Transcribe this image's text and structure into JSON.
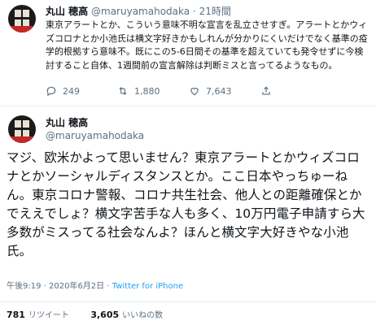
{
  "tweet1": {
    "display_name": "丸山 穂高",
    "handle": "@maruyamahodaka",
    "separator": "·",
    "time": "21時間",
    "text": "東京アラートとか、こういう意味不明な宣言を乱立させすぎ。アラートとかウィズコロナとか小池氏は横文字好きかもしれんが分かりにくいだけでなく基準の疫学的根拠すら意味不。既にこの5-6日間その基準を超えていても発令せずに今検討すること自体、1週間前の宣言解除は判断ミスと言ってるようなもの。",
    "actions": {
      "reply_count": "249",
      "retweet_count": "1,880",
      "like_count": "7,643"
    }
  },
  "tweet2": {
    "display_name": "丸山 穂高",
    "handle": "@maruyamahodaka",
    "text": "マジ、欧米かよって思いません？東京アラートとかウィズコロナとかソーシャルディスタンスとか。ここ日本やっちゅーねん。東京コロナ警報、コロナ共生社会、他人との距離確保とかでええでしょ？横文字苦手な人も多く、10万円電子申請すら大多数がミスってる社会なんよ？ほんと横文字大好きやな小池氏。",
    "meta": {
      "timestamp": "午後9:19 · 2020年6月2日",
      "separator": "·",
      "source": "Twitter for iPhone"
    },
    "stats": {
      "retweets_value": "781",
      "retweets_label": "リツイート",
      "likes_value": "3,605",
      "likes_label": "いいねの数"
    }
  },
  "colors": {
    "text": "#0f1419",
    "muted": "#5b7083",
    "link": "#1da1f2",
    "divider": "#e6ecf0"
  },
  "icons": [
    "avatar",
    "reply-icon",
    "retweet-icon",
    "like-icon",
    "share-icon"
  ]
}
